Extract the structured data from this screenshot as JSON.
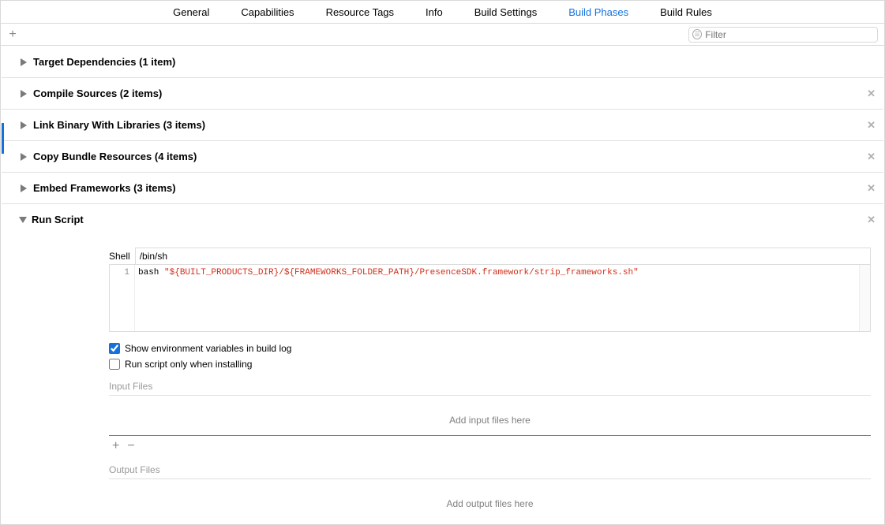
{
  "tabs": [
    "General",
    "Capabilities",
    "Resource Tags",
    "Info",
    "Build Settings",
    "Build Phases",
    "Build Rules"
  ],
  "active_tab_index": 5,
  "filter": {
    "placeholder": "Filter"
  },
  "phases": [
    {
      "title": "Target Dependencies (1 item)",
      "removable": false
    },
    {
      "title": "Compile Sources (2 items)",
      "removable": true
    },
    {
      "title": "Link Binary With Libraries (3 items)",
      "removable": true
    },
    {
      "title": "Copy Bundle Resources (4 items)",
      "removable": true
    },
    {
      "title": "Embed Frameworks (3 items)",
      "removable": true
    }
  ],
  "runscript": {
    "title": "Run Script",
    "shell_label": "Shell",
    "shell_value": "/bin/sh",
    "line_no": "1",
    "code_plain": "bash ",
    "code_string": "\"${BUILT_PRODUCTS_DIR}/${FRAMEWORKS_FOLDER_PATH}/PresenceSDK.framework/strip_frameworks.sh\"",
    "show_env_label": "Show environment variables in build log",
    "show_env_checked": true,
    "only_install_label": "Run script only when installing",
    "only_install_checked": false,
    "input_files_label": "Input Files",
    "input_files_placeholder": "Add input files here",
    "output_files_label": "Output Files",
    "output_files_placeholder": "Add output files here"
  }
}
